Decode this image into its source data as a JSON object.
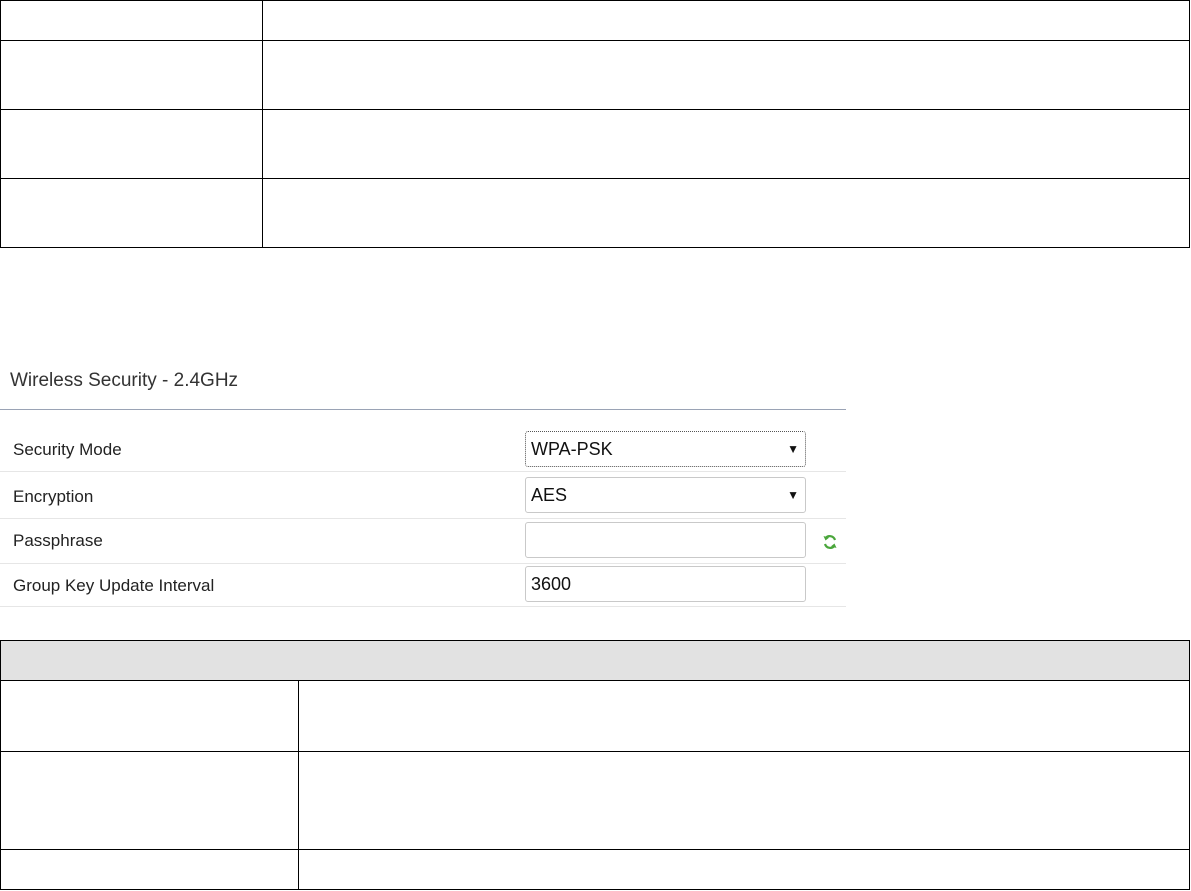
{
  "wireless_security": {
    "title": "Wireless Security - 2.4GHz",
    "fields": [
      {
        "label": "Security Mode",
        "type": "select",
        "value": "WPA-PSK"
      },
      {
        "label": "Encryption",
        "type": "select",
        "value": "AES"
      },
      {
        "label": "Passphrase",
        "type": "text",
        "value": ""
      },
      {
        "label": "Group Key Update Interval",
        "type": "text",
        "value": "3600"
      }
    ]
  },
  "icons": {
    "passphrase_action": "refresh-icon",
    "select_arrow": "▼"
  },
  "colors": {
    "refresh_icon": "#4aa63b",
    "table_header_bg": "#e2e2e2",
    "panel_rule": "#9aa3b5"
  }
}
